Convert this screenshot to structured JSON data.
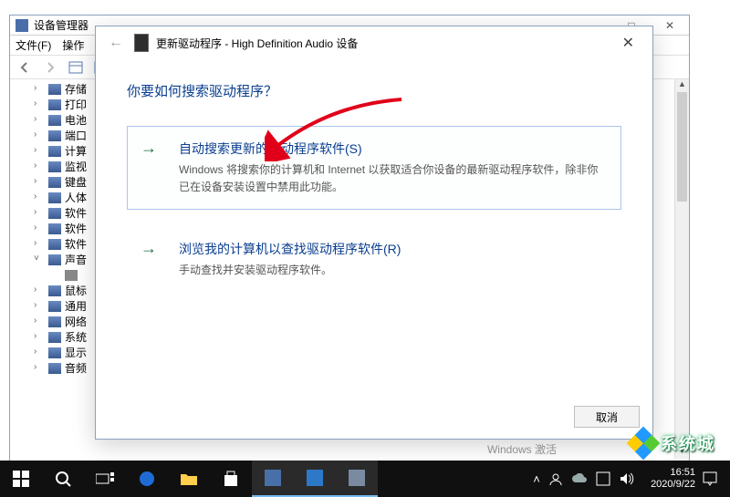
{
  "devmgr": {
    "title": "设备管理器",
    "window_controls": {
      "min": "—",
      "max": "□",
      "close": "✕"
    },
    "menu": {
      "file": "文件(F)",
      "action": "操作"
    },
    "tree": [
      "存储",
      "打印",
      "电池",
      "端口",
      "计算",
      "监视",
      "键盘",
      "人体",
      "软件",
      "软件",
      "软件",
      "声音",
      "鼠标",
      "通用",
      "网络",
      "系统",
      "显示",
      "音频"
    ]
  },
  "dialog": {
    "back_glyph": "←",
    "title": "更新驱动程序 - High Definition Audio 设备",
    "close_glyph": "✕",
    "question": "你要如何搜索驱动程序？",
    "option1": {
      "arrow": "→",
      "title": "自动搜索更新的驱动程序软件(S)",
      "desc": "Windows 将搜索你的计算机和 Internet 以获取适合你设备的最新驱动程序软件，除非你已在设备安装设置中禁用此功能。"
    },
    "option2": {
      "arrow": "→",
      "title": "浏览我的计算机以查找驱动程序软件(R)",
      "desc": "手动查找并安装驱动程序软件。"
    },
    "cancel": "取消"
  },
  "taskbar": {
    "tray_up": "˄",
    "clock_time": "16:51",
    "clock_date": "2020/9/22"
  },
  "watermark": {
    "text": "系统城"
  },
  "activate": {
    "line1": "Windows 激活"
  }
}
